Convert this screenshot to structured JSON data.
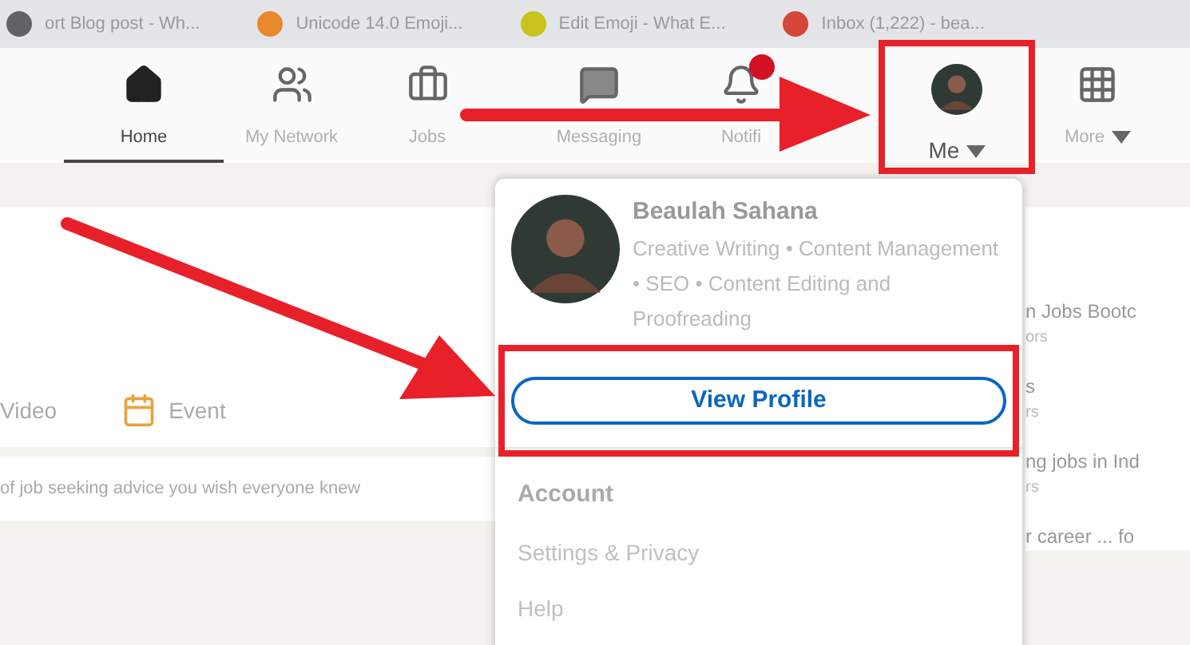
{
  "browser_tabs": [
    {
      "title": "ort Blog post - Wh...",
      "color": "#5f6368"
    },
    {
      "title": "Unicode 14.0 Emoji...",
      "color": "#e8892b"
    },
    {
      "title": "Edit Emoji - What E...",
      "color": "#c9c21c"
    },
    {
      "title": "Inbox (1,222) - bea...",
      "color": "#d44638"
    }
  ],
  "nav": [
    {
      "label": "Home",
      "kind": "home",
      "selected": true,
      "badge": false,
      "dropdown": false
    },
    {
      "label": "My Network",
      "kind": "network",
      "selected": false,
      "badge": false,
      "dropdown": false
    },
    {
      "label": "Jobs",
      "kind": "jobs",
      "selected": false,
      "badge": false,
      "dropdown": false
    },
    {
      "label": "Messaging",
      "kind": "messaging",
      "selected": false,
      "badge": false,
      "dropdown": false
    },
    {
      "label": "Notifi",
      "kind": "notifications",
      "selected": false,
      "badge": true,
      "dropdown": false
    },
    {
      "label": "Me",
      "kind": "profile",
      "selected": false,
      "badge": false,
      "dropdown": true
    },
    {
      "label": "More",
      "kind": "grid",
      "selected": false,
      "badge": false,
      "dropdown": true
    }
  ],
  "composer": {
    "actions": [
      {
        "label": "Video",
        "kind": "video"
      },
      {
        "label": "Event",
        "kind": "event"
      }
    ]
  },
  "feed_text": "of job seeking advice you wish everyone knew",
  "news": [
    {
      "title": "n Jobs Bootc",
      "sub": "ors"
    },
    {
      "title": "s",
      "sub": "rs"
    },
    {
      "title": "ng jobs in Ind",
      "sub": "rs"
    },
    {
      "title": "r career ... fo"
    }
  ],
  "profile_menu": {
    "name": "Beaulah Sahana",
    "headline": "Creative Writing • Content Management • SEO • Content Editing and Proofreading",
    "button": "View Profile",
    "section": "Account",
    "items": [
      "Settings & Privacy",
      "Help"
    ]
  }
}
